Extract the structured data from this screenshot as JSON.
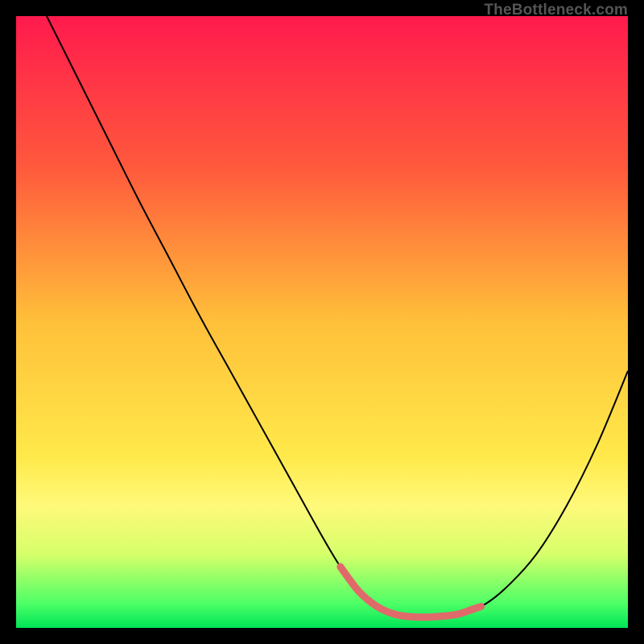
{
  "watermark": "TheBottleneck.com",
  "chart_data": {
    "type": "line",
    "title": "",
    "xlabel": "",
    "ylabel": "",
    "xlim": [
      0,
      100
    ],
    "ylim": [
      0,
      100
    ],
    "background_gradient_stops": [
      {
        "offset": 0,
        "color": "#ff1a4d"
      },
      {
        "offset": 25,
        "color": "#ff5a3c"
      },
      {
        "offset": 50,
        "color": "#ffc03a"
      },
      {
        "offset": 72,
        "color": "#ffe94a"
      },
      {
        "offset": 80,
        "color": "#fff97a"
      },
      {
        "offset": 88,
        "color": "#d6ff6a"
      },
      {
        "offset": 96,
        "color": "#4dff66"
      },
      {
        "offset": 100,
        "color": "#00e558"
      }
    ],
    "series": [
      {
        "name": "bottleneck-curve",
        "color": "#000000",
        "stroke_width": 2,
        "x": [
          5,
          10,
          15,
          20,
          25,
          30,
          35,
          40,
          45,
          50,
          53,
          56,
          59,
          62,
          65,
          68,
          72,
          76,
          80,
          85,
          90,
          95,
          100
        ],
        "y": [
          100,
          90,
          80,
          70,
          60.5,
          51,
          42,
          33,
          24,
          15,
          10,
          6,
          3.5,
          2.2,
          1.8,
          1.8,
          2.2,
          3.5,
          6.5,
          12,
          20,
          30,
          42
        ]
      },
      {
        "name": "optimal-band",
        "color": "#e06a6a",
        "stroke_width": 9,
        "x": [
          53,
          56,
          59,
          62,
          65,
          68,
          72,
          74.5,
          76
        ],
        "y": [
          10,
          6,
          3.5,
          2.2,
          1.8,
          1.8,
          2.2,
          3,
          3.5
        ]
      }
    ]
  }
}
